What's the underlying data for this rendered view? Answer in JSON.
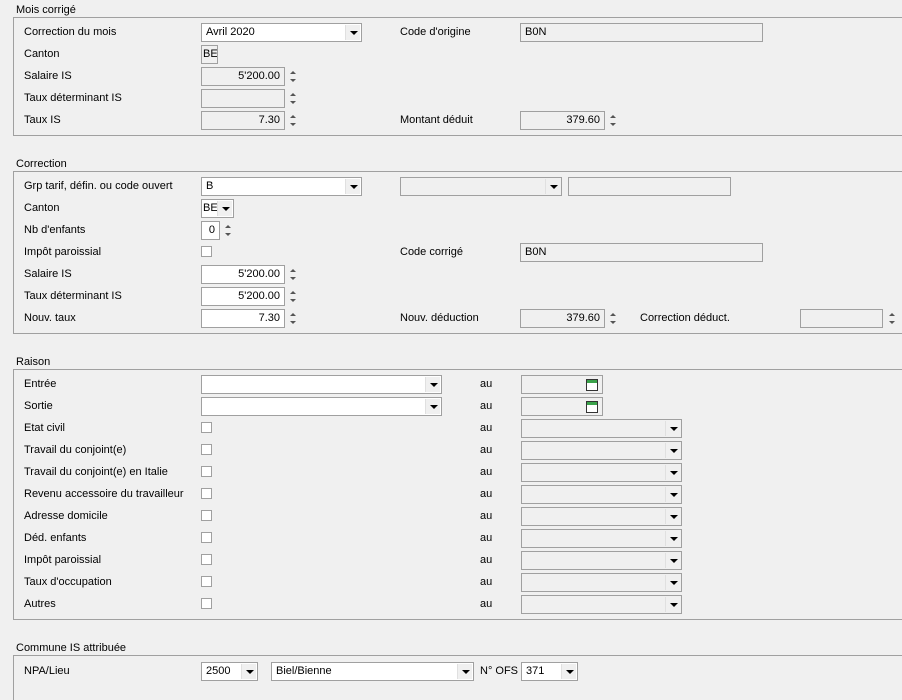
{
  "mois_corrige": {
    "title": "Mois corrigé",
    "correction_du_mois_label": "Correction du mois",
    "correction_du_mois_value": "Avril 2020",
    "code_origine_label": "Code d'origine",
    "code_origine_value": "B0N",
    "canton_label": "Canton",
    "canton_value": "BE",
    "salaire_is_label": "Salaire IS",
    "salaire_is_value": "5'200.00",
    "taux_determinant_label": "Taux déterminant IS",
    "taux_determinant_value": "",
    "taux_is_label": "Taux IS",
    "taux_is_value": "7.30",
    "montant_deduit_label": "Montant déduit",
    "montant_deduit_value": "379.60"
  },
  "correction": {
    "title": "Correction",
    "grp_tarif_label": "Grp tarif, défin. ou code ouvert",
    "grp_tarif_value": "B",
    "grp_tarif_extra_value": "",
    "grp_tarif_text_value": "",
    "canton_label": "Canton",
    "canton_value": "BE",
    "nb_enfants_label": "Nb d'enfants",
    "nb_enfants_value": "0",
    "impot_paroissial_label": "Impôt paroissial",
    "code_corrige_label": "Code corrigé",
    "code_corrige_value": "B0N",
    "salaire_is_label": "Salaire IS",
    "salaire_is_value": "5'200.00",
    "taux_determinant_label": "Taux déterminant IS",
    "taux_determinant_value": "5'200.00",
    "nouv_taux_label": "Nouv. taux",
    "nouv_taux_value": "7.30",
    "nouv_deduction_label": "Nouv. déduction",
    "nouv_deduction_value": "379.60",
    "correction_deduct_label": "Correction déduct.",
    "correction_deduct_value": ""
  },
  "raison": {
    "title": "Raison",
    "au_label": "au",
    "rows": [
      {
        "label": "Entrée"
      },
      {
        "label": "Sortie"
      },
      {
        "label": "Etat civil"
      },
      {
        "label": "Travail du conjoint(e)"
      },
      {
        "label": "Travail du conjoint(e) en Italie"
      },
      {
        "label": "Revenu accessoire du travailleur"
      },
      {
        "label": "Adresse domicile"
      },
      {
        "label": "Déd. enfants"
      },
      {
        "label": "Impôt paroissial"
      },
      {
        "label": "Taux d'occupation"
      },
      {
        "label": "Autres"
      }
    ]
  },
  "commune": {
    "title": "Commune IS attribuée",
    "npa_label": "NPA/Lieu",
    "npa_value": "2500",
    "lieu_value": "Biel/Bienne",
    "ofs_label": "N° OFS",
    "ofs_value": "371"
  }
}
